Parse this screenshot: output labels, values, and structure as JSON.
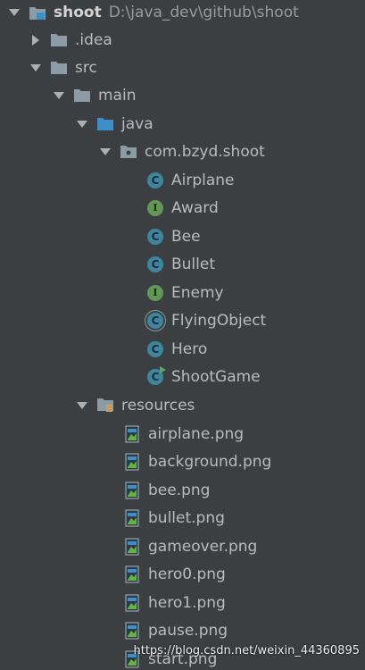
{
  "tree": {
    "root": {
      "name": "shoot",
      "path": "D:\\java_dev\\github\\shoot"
    },
    "idea": {
      "name": ".idea"
    },
    "src": {
      "name": "src"
    },
    "main": {
      "name": "main"
    },
    "java": {
      "name": "java"
    },
    "package": {
      "name": "com.bzyd.shoot"
    },
    "classes": [
      {
        "name": "Airplane",
        "kind": "class"
      },
      {
        "name": "Award",
        "kind": "interface"
      },
      {
        "name": "Bee",
        "kind": "class"
      },
      {
        "name": "Bullet",
        "kind": "class"
      },
      {
        "name": "Enemy",
        "kind": "interface"
      },
      {
        "name": "FlyingObject",
        "kind": "abstract-class"
      },
      {
        "name": "Hero",
        "kind": "class"
      },
      {
        "name": "ShootGame",
        "kind": "runnable-class"
      }
    ],
    "resources": {
      "name": "resources"
    },
    "files": [
      "airplane.png",
      "background.png",
      "bee.png",
      "bullet.png",
      "gameover.png",
      "hero0.png",
      "hero1.png",
      "pause.png",
      "start.png"
    ]
  },
  "watermark": "https://blog.csdn.net/weixin_44360895",
  "colors": {
    "background": "#3c3f41",
    "text": "#bbbbbb",
    "class_icon": "#3e86a0",
    "interface_icon": "#629755",
    "folder": "#8c9ca6",
    "source_folder": "#3d8fc9"
  }
}
